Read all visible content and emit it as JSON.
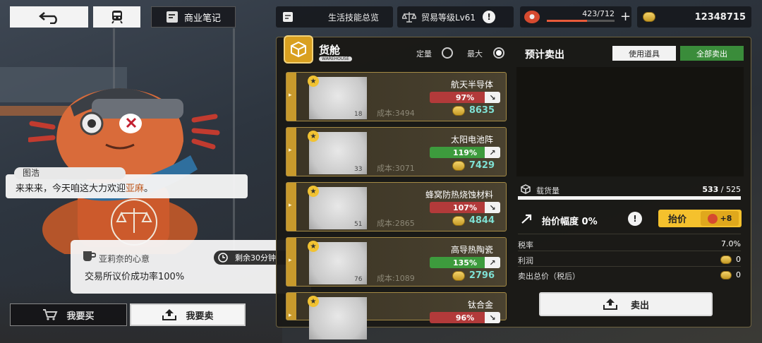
{
  "topbar": {
    "notes_label": "商业笔记",
    "life_skills_label": "生活技能总览",
    "trade_level_label": "贸易等级Lv61",
    "stamina": "423/712",
    "stamina_fraction": 0.594,
    "coins": "12348715"
  },
  "dialog": {
    "speaker": "图浩",
    "text_prefix": "来来来，今天咱这大力欢迎",
    "text_highlight": "亚麻",
    "text_suffix": "。"
  },
  "buff": {
    "name": "亚莉奈的心意",
    "description": "交易所议价成功率100%",
    "timer": "剩余30分钟"
  },
  "mode": {
    "buy": "我要买",
    "sell": "我要卖"
  },
  "warehouse": {
    "title": "货舱",
    "subtitle": "WAREHOUSE",
    "fixed_label": "定量",
    "max_label": "最大",
    "items": [
      {
        "name": "航天半导体",
        "pct": "97%",
        "trend": "down",
        "qty": "18",
        "cost": "成本:3494",
        "price": "8635"
      },
      {
        "name": "太阳电池阵",
        "pct": "119%",
        "trend": "up",
        "qty": "33",
        "cost": "成本:3071",
        "price": "7429"
      },
      {
        "name": "蜂窝防热烧蚀材料",
        "pct": "107%",
        "trend": "down",
        "qty": "51",
        "cost": "成本:2865",
        "price": "4844"
      },
      {
        "name": "高导热陶瓷",
        "pct": "135%",
        "trend": "up",
        "qty": "76",
        "cost": "成本:1089",
        "price": "2796"
      },
      {
        "name": "钛合金",
        "pct": "96%",
        "trend": "down",
        "qty": "",
        "cost": "",
        "price": ""
      }
    ]
  },
  "sell_panel": {
    "title": "预计卖出",
    "use_item": "使用道具",
    "sell_all": "全部卖出",
    "cargo_label": "载货量",
    "cargo_used": "533",
    "cargo_sep": "/",
    "cargo_max": "525",
    "raise_label": "抬价幅度 0%",
    "raise_button": "抬价",
    "raise_cost": "+8",
    "tax_label": "税率",
    "tax_value": "7.0%",
    "profit_label": "利润",
    "profit_value": "0",
    "total_label": "卖出总价（税后）",
    "total_value": "0",
    "sell_button": "卖出"
  }
}
